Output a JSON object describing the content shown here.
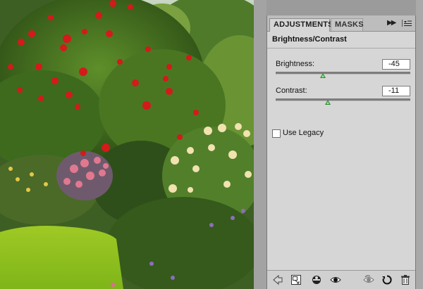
{
  "panel": {
    "tabs": [
      {
        "label": "ADJUSTMENTS",
        "active": true
      },
      {
        "label": "MASKS",
        "active": false
      }
    ],
    "adjustment_title": "Brightness/Contrast",
    "brightness": {
      "label": "Brightness:",
      "value": "-45",
      "slider_fraction": 0.35
    },
    "contrast": {
      "label": "Contrast:",
      "value": "-11",
      "slider_fraction": 0.39
    },
    "use_legacy": {
      "label": "Use Legacy",
      "checked": false
    }
  },
  "icons": {
    "collapse": "double-chevron-right-icon",
    "menu": "panel-menu-icon",
    "footer": [
      "return-arrow-icon",
      "clip-to-layer-icon",
      "previous-state-icon",
      "visibility-eye-icon",
      "view-previous-icon",
      "reset-icon",
      "trash-icon"
    ]
  },
  "colors": {
    "slider_thumb": "#2e8b2e",
    "panel_bg": "#d6d6d6"
  }
}
